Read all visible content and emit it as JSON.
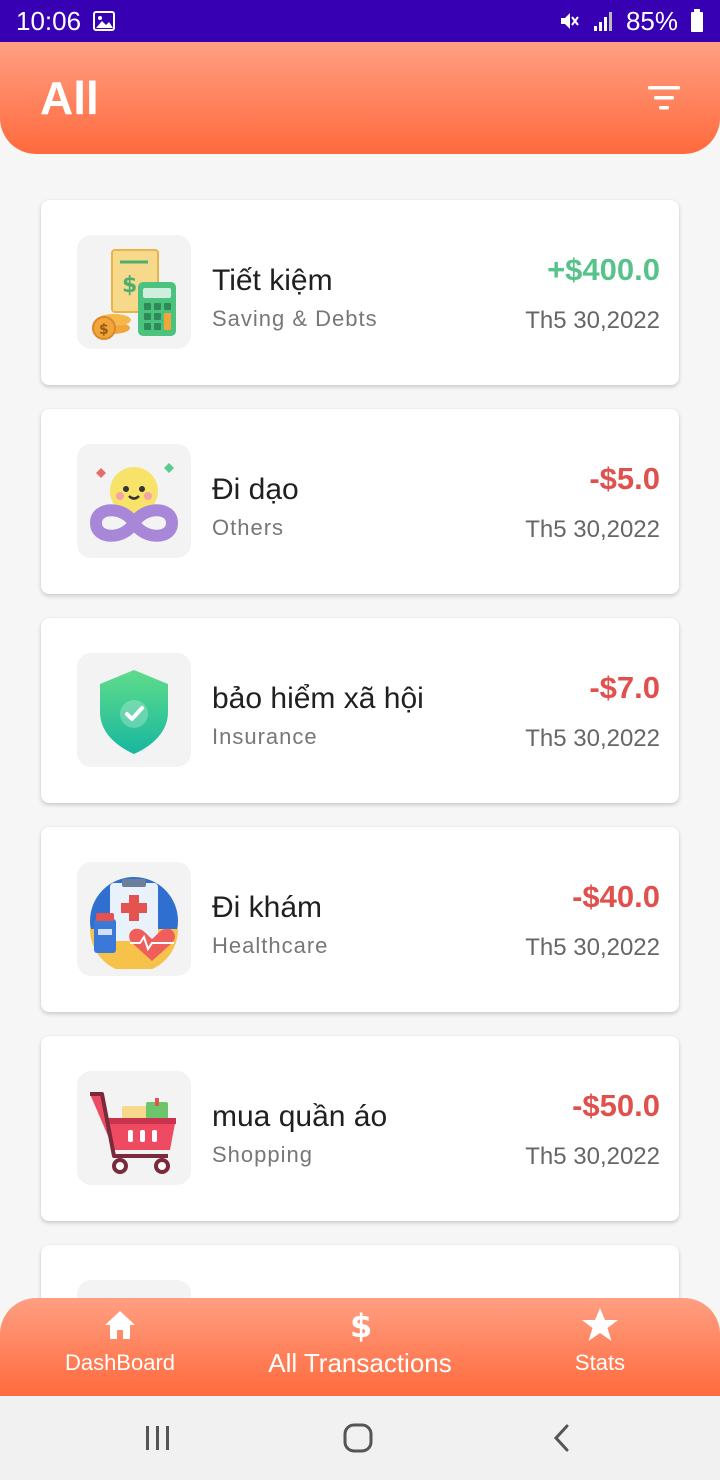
{
  "status_bar": {
    "time": "10:06",
    "battery": "85%"
  },
  "header": {
    "title": "All"
  },
  "transactions": [
    {
      "title": "Tiết kiệm",
      "category": "Saving & Debts",
      "amount": "+$400.0",
      "date": "Th5 30,2022",
      "icon": "savings-calculator-icon"
    },
    {
      "title": "Đi dạo",
      "category": "Others",
      "amount": "-$5.0",
      "date": "Th5 30,2022",
      "icon": "infinity-emoji-icon"
    },
    {
      "title": "bảo hiểm xã hội",
      "category": "Insurance",
      "amount": "-$7.0",
      "date": "Th5 30,2022",
      "icon": "shield-check-icon"
    },
    {
      "title": "Đi khám",
      "category": "Healthcare",
      "amount": "-$40.0",
      "date": "Th5 30,2022",
      "icon": "medical-clipboard-icon"
    },
    {
      "title": "mua quần áo",
      "category": "Shopping",
      "amount": "-$50.0",
      "date": "Th5 30,2022",
      "icon": "shopping-cart-icon"
    }
  ],
  "bottom_nav": {
    "items": [
      {
        "label": "DashBoard",
        "icon": "home-icon"
      },
      {
        "label": "All Transactions",
        "icon": "dollar-icon"
      },
      {
        "label": "Stats",
        "icon": "star-icon"
      }
    ]
  },
  "colors": {
    "accent": "#ff6a3d",
    "status_bar": "#3700b3",
    "income": "#57c38a",
    "expense": "#e0514e"
  }
}
